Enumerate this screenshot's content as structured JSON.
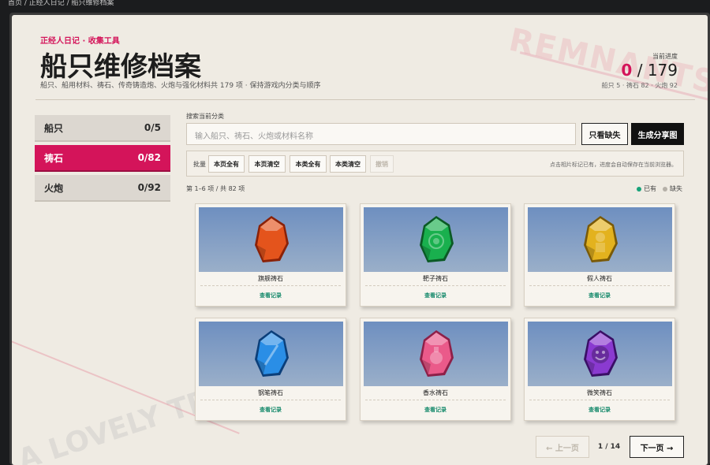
{
  "breadcrumb": "首页 / 正经人日记 / 船只维修档案",
  "header": {
    "eyebrow": "正经人日记 · 收集工具",
    "title": "船只维修档案",
    "subtitle": "船只、船用材料、祷石、传奇铸造炮、火炮与强化材料共 179 项 · 保持游戏内分类与顺序",
    "progress_label": "当前进度",
    "progress_done": "0",
    "progress_sep": "/",
    "progress_total": "179",
    "progress_sub": "船只 5 · 祷石 82 · 火炮 92"
  },
  "watermarks": {
    "top": "REMNANTS",
    "bottom": "A LOVELY TRIP?"
  },
  "sidebar": {
    "items": [
      {
        "label": "船只",
        "count": "0/5",
        "active": false
      },
      {
        "label": "祷石",
        "count": "0/82",
        "active": true
      },
      {
        "label": "火炮",
        "count": "0/92",
        "active": false
      }
    ]
  },
  "search": {
    "label": "搜索当前分类",
    "placeholder": "输入船只、祷石、火炮或材料名称",
    "missing_only": "只看缺失",
    "share": "生成分享图"
  },
  "batch": {
    "label": "批量",
    "buttons": [
      "本页全有",
      "本页清空",
      "本类全有",
      "本类清空",
      "撤销"
    ],
    "hint": "点击相片标记已有，进度会自动保存在当前浏览器。"
  },
  "list": {
    "count_text": "第 1–6 项 / 共 82 项",
    "legend_have": "已有",
    "legend_missing": "缺失",
    "colors": {
      "have": "#17a37a",
      "missing": "#b5b0a8",
      "accent": "#d4145a"
    },
    "cards": [
      {
        "name": "旗舰祷石",
        "link": "查看记录",
        "gem_color": "#e4541c",
        "gem_dark": "#8a2208",
        "gem_icon": "plain-gem-icon"
      },
      {
        "name": "靶子祷石",
        "link": "查看记录",
        "gem_color": "#19b04e",
        "gem_dark": "#0b5a25",
        "gem_icon": "target-gem-icon"
      },
      {
        "name": "假人祷石",
        "link": "查看记录",
        "gem_color": "#e3b21e",
        "gem_dark": "#7a5a08",
        "gem_icon": "dummy-gem-icon"
      },
      {
        "name": "钢笔祷石",
        "link": "查看记录",
        "gem_color": "#2a8ee6",
        "gem_dark": "#0b3f7a",
        "gem_icon": "pen-gem-icon"
      },
      {
        "name": "香水祷石",
        "link": "查看记录",
        "gem_color": "#ea5a8a",
        "gem_dark": "#8e2048",
        "gem_icon": "perfume-gem-icon"
      },
      {
        "name": "微笑祷石",
        "link": "查看记录",
        "gem_color": "#8a3ad0",
        "gem_dark": "#3a0f66",
        "gem_icon": "smile-gem-icon"
      }
    ]
  },
  "pager": {
    "prev": "← 上一页",
    "page": "1 / 14",
    "next": "下一页 →"
  }
}
